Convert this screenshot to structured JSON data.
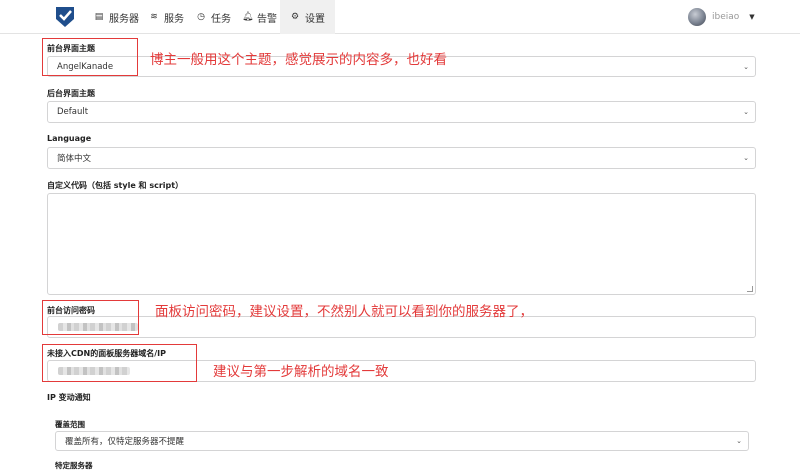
{
  "nav": {
    "items": [
      {
        "label": "服务器",
        "icon": "server-icon"
      },
      {
        "label": "服务",
        "icon": "rss-icon"
      },
      {
        "label": "任务",
        "icon": "clock-icon"
      },
      {
        "label": "告警",
        "icon": "bell-icon"
      },
      {
        "label": "设置",
        "icon": "cogs-icon",
        "active": true
      }
    ],
    "user": {
      "name": "ibeiao"
    }
  },
  "form": {
    "front_theme": {
      "label": "前台界面主题",
      "value": "AngelKanade"
    },
    "back_theme": {
      "label": "后台界面主题",
      "value": "Default"
    },
    "language": {
      "label": "Language",
      "value": "简体中文"
    },
    "custom_code": {
      "label": "自定义代码（包括 style 和 script）",
      "value": ""
    },
    "access_password": {
      "label": "前台访问密码"
    },
    "dashboard_domain": {
      "label": "未接入CDN的面板服务器域名/IP"
    },
    "ip_change": {
      "label": "IP 变动通知",
      "coverage": {
        "label": "覆盖范围",
        "value": "覆盖所有，仅特定服务器不提醒"
      },
      "specific_label": "特定服务器"
    }
  },
  "annotations": {
    "theme_note": "博主一般用这个主题，感觉展示的内容多，也好看",
    "password_note": "面板访问密码，建议设置，不然别人就可以看到你的服务器了，",
    "domain_note": "建议与第一步解析的域名一致"
  },
  "colors": {
    "annotation": "#e33a3a",
    "border": "#d4d4d5",
    "active_nav": "#f0f0f0"
  }
}
